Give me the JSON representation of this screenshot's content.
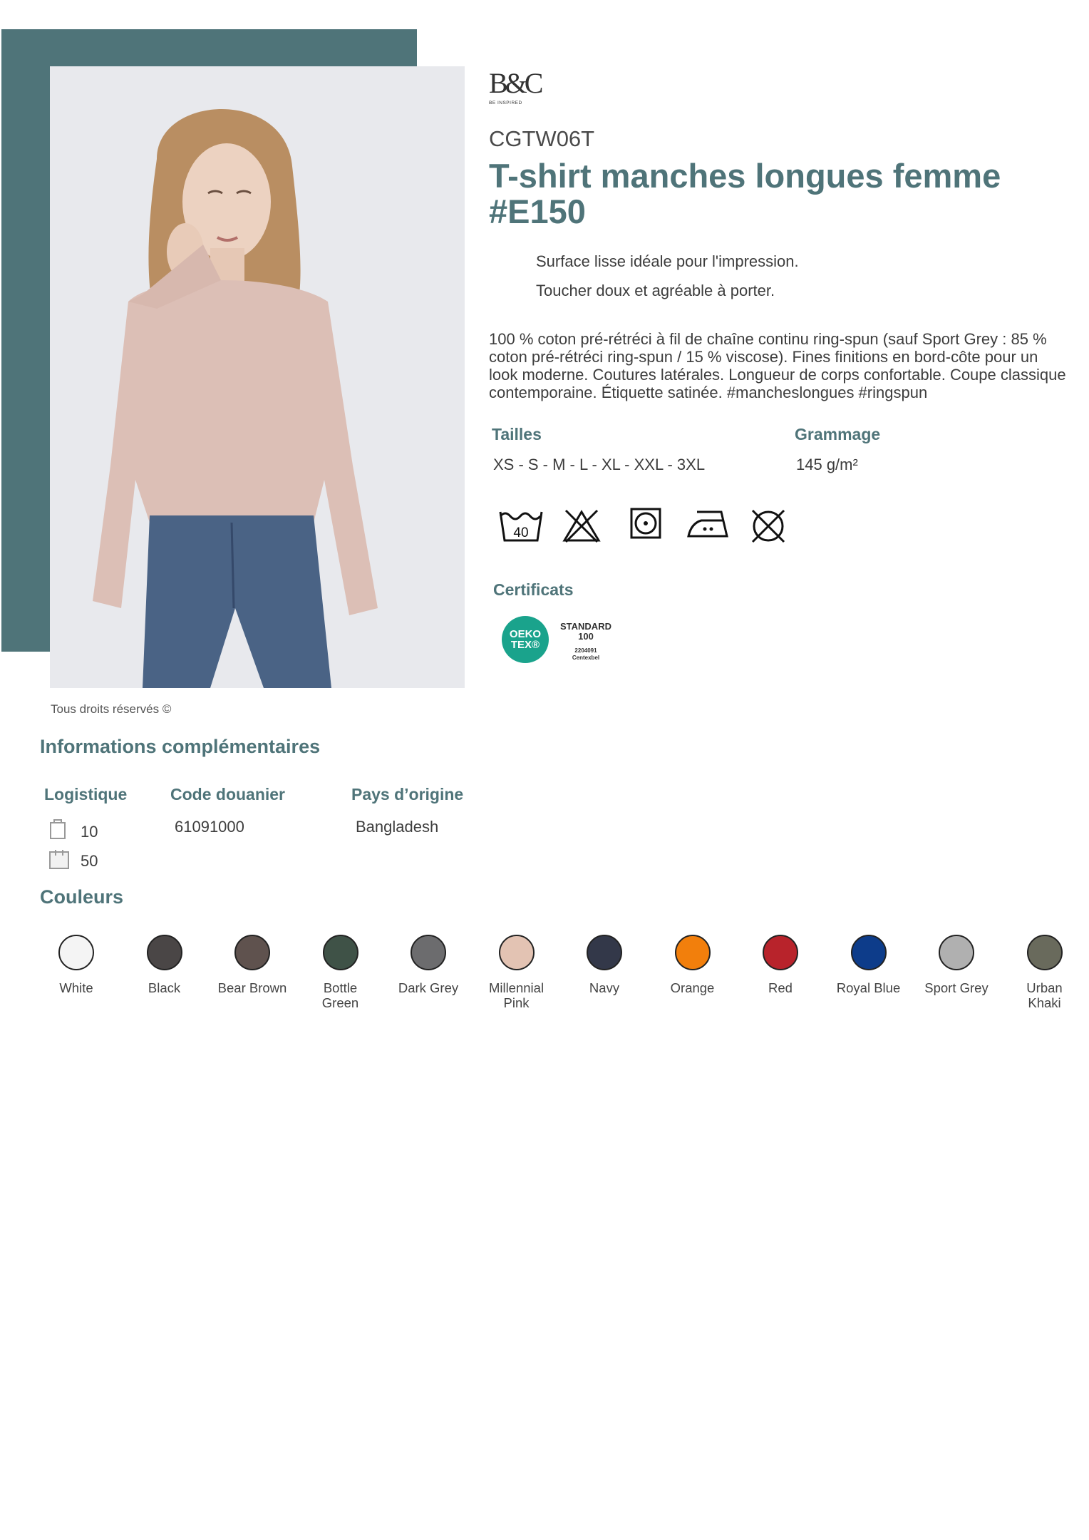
{
  "brand": {
    "logo": "B&C",
    "tagline": "BE INSPIRED"
  },
  "product": {
    "sku": "CGTW06T",
    "title": "T-shirt manches longues femme #E150",
    "bullets": [
      "Surface lisse idéale pour l'impression.",
      "Toucher doux et agréable à porter."
    ],
    "description": "100 % coton pré-rétréci à fil de chaîne continu ring-spun (sauf Sport Grey : 85 % coton pré-rétréci ring-spun / 15 % viscose). Fines finitions en bord-côte pour un look moderne. Coutures latérales. Longueur de corps confortable. Coupe classique contemporaine. Étiquette satinée. #mancheslongues #ringspun",
    "image_caption": "Tous droits réservés ©"
  },
  "specs": {
    "sizes_label": "Tailles",
    "sizes_value": "XS - S - M - L - XL - XXL - 3XL",
    "weight_label": "Grammage",
    "weight_value": "145 g/m²"
  },
  "care_icons": [
    {
      "name": "wash-40-icon",
      "text": "40"
    },
    {
      "name": "no-bleach-icon"
    },
    {
      "name": "tumble-dry-icon"
    },
    {
      "name": "iron-medium-icon"
    },
    {
      "name": "no-dry-clean-icon"
    }
  ],
  "certificates": {
    "label": "Certificats",
    "oeko_line1": "OEKO",
    "oeko_line2": "TEX®",
    "standard": "STANDARD",
    "standard_num": "100",
    "cert_number": "2204091",
    "cert_body": "Centexbel"
  },
  "info": {
    "title": "Informations complémentaires",
    "logistics_label": "Logistique",
    "customs_label": "Code douanier",
    "origin_label": "Pays d’origine",
    "pack_small": "10",
    "pack_large": "50",
    "customs_code": "61091000",
    "origin": "Bangladesh"
  },
  "colors": {
    "title": "Couleurs",
    "items": [
      {
        "name": "White",
        "hex": "#f4f4f4"
      },
      {
        "name": "Black",
        "hex": "#4a4646"
      },
      {
        "name": "Bear Brown",
        "hex": "#5f524e"
      },
      {
        "name": "Bottle Green",
        "hex": "#3f5247"
      },
      {
        "name": "Dark Grey",
        "hex": "#6c6c6e"
      },
      {
        "name": "Millennial Pink",
        "hex": "#e3c3b3"
      },
      {
        "name": "Navy",
        "hex": "#333849"
      },
      {
        "name": "Orange",
        "hex": "#f27f0c"
      },
      {
        "name": "Red",
        "hex": "#b8232b"
      },
      {
        "name": "Royal Blue",
        "hex": "#0d3c8a"
      },
      {
        "name": "Sport Grey",
        "hex": "#b0b0b0"
      },
      {
        "name": "Urban Khaki",
        "hex": "#696a5c"
      }
    ]
  }
}
